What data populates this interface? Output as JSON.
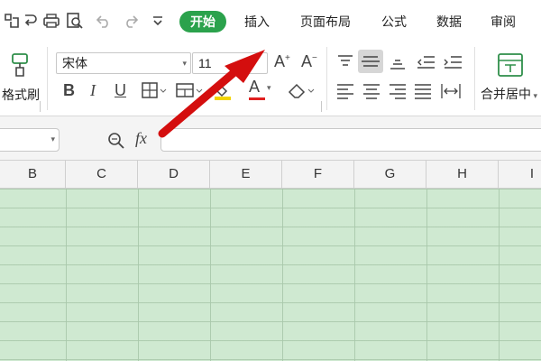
{
  "tabs": [
    {
      "label": "开始",
      "active": true
    },
    {
      "label": "插入",
      "active": false
    },
    {
      "label": "页面布局",
      "active": false
    },
    {
      "label": "公式",
      "active": false
    },
    {
      "label": "数据",
      "active": false
    },
    {
      "label": "审阅",
      "active": false
    }
  ],
  "quick_access_icons": [
    "restore-icon",
    "print-icon",
    "print-preview-icon",
    "undo-icon",
    "redo-icon",
    "customize-dropdown-icon"
  ],
  "ribbon": {
    "format_painter_label": "格式刷",
    "font_name": "宋体",
    "font_size": "11",
    "merge_label": "合并居中",
    "bold": "B",
    "italic": "I",
    "underline": "U",
    "font_color_letter": "A",
    "grow_font": "A",
    "shrink_font": "A"
  },
  "formula_bar": {
    "zoom_icon": "zoom-formula-icon",
    "fx_label": "fx"
  },
  "columns": [
    "B",
    "C",
    "D",
    "E",
    "F",
    "G",
    "H",
    "I"
  ],
  "colors": {
    "accent": "#2ba24c",
    "sheet_bg": "#cfe9d1",
    "arrow": "#e01010"
  }
}
